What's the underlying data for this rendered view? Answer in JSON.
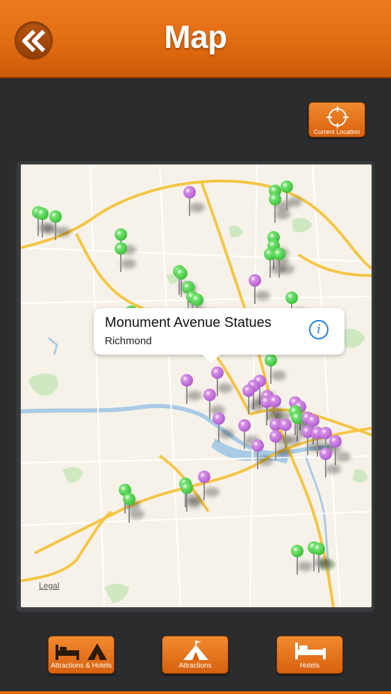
{
  "header": {
    "title": "Map",
    "back_icon": "double-chevron-left-icon",
    "accent_color": "#e8721a"
  },
  "toolbar": {
    "current_location_label": "Current Location",
    "current_location_icon": "crosshair-icon"
  },
  "map": {
    "callout": {
      "title": "Monument Avenue Statues",
      "subtitle": "Richmond",
      "info_icon": "info-icon"
    },
    "legal_label": "Legal",
    "pin_colors": {
      "hotel": "#4cd24a",
      "attraction": "#c070dd"
    }
  },
  "tabs": [
    {
      "label": "Attractions & Hotels",
      "icon": "bed-and-tent-icon",
      "selected": true
    },
    {
      "label": "Attractions",
      "icon": "tent-icon",
      "selected": false
    },
    {
      "label": "Hotels",
      "icon": "bed-icon",
      "selected": false
    }
  ]
}
